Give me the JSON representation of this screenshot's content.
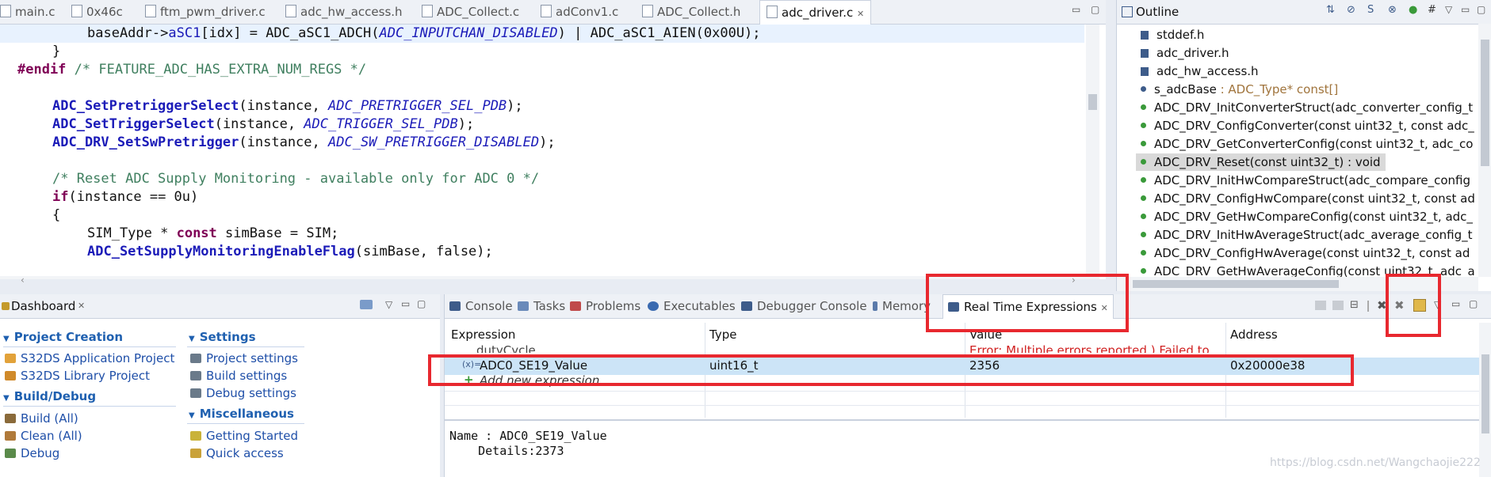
{
  "editor": {
    "tabs": [
      "main.c",
      "0x46c",
      "ftm_pwm_driver.c",
      "adc_hw_access.h",
      "ADC_Collect.c",
      "adConv1.c",
      "ADC_Collect.h",
      "adc_driver.c"
    ],
    "active_tab_close": "✕",
    "lines": {
      "l1_a": "baseAddr->",
      "l1_b": "aSC1",
      "l1_c": "[idx] = ADC_aSC1_ADCH(",
      "l1_d": "ADC_INPUTCHAN_DISABLED",
      "l1_e": ") | ADC_aSC1_AIEN(0x00U);",
      "l2": "}",
      "l3_a": "#endif",
      "l3_b": " /* FEATURE_ADC_HAS_EXTRA_NUM_REGS */",
      "l4_a": "ADC_SetPretriggerSelect",
      "l4_b": "(instance, ",
      "l4_c": "ADC_PRETRIGGER_SEL_PDB",
      "l4_d": ");",
      "l5_a": "ADC_SetTriggerSelect",
      "l5_b": "(instance, ",
      "l5_c": "ADC_TRIGGER_SEL_PDB",
      "l5_d": ");",
      "l6_a": "ADC_DRV_SetSwPretrigger",
      "l6_b": "(instance, ",
      "l6_c": "ADC_SW_PRETRIGGER_DISABLED",
      "l6_d": ");",
      "l7": "/* Reset ADC Supply Monitoring - available only for ADC 0 */",
      "l8_a": "if",
      "l8_b": "(instance == 0u)",
      "l9": "{",
      "l10_a": "SIM_Type * ",
      "l10_b": "const",
      "l10_c": " simBase = SIM;",
      "l11_a": "ADC_SetSupplyMonitoringEnableFlag",
      "l11_b": "(simBase, false);"
    }
  },
  "outline": {
    "title": "Outline",
    "items": [
      {
        "label": "stddef.h",
        "kind": "header"
      },
      {
        "label": "adc_driver.h",
        "kind": "header"
      },
      {
        "label": "adc_hw_access.h",
        "kind": "header"
      },
      {
        "label": "s_adcBase",
        "type": " : ADC_Type* const[]",
        "kind": "static"
      },
      {
        "label": "ADC_DRV_InitConverterStruct(adc_converter_config_t",
        "kind": "fn"
      },
      {
        "label": "ADC_DRV_ConfigConverter(const uint32_t, const adc_",
        "kind": "fn"
      },
      {
        "label": "ADC_DRV_GetConverterConfig(const uint32_t, adc_co",
        "kind": "fn"
      },
      {
        "label": "ADC_DRV_Reset(const uint32_t) : void",
        "kind": "fn",
        "selected": true
      },
      {
        "label": "ADC_DRV_InitHwCompareStruct(adc_compare_config",
        "kind": "fn"
      },
      {
        "label": "ADC_DRV_ConfigHwCompare(const uint32_t, const ad",
        "kind": "fn"
      },
      {
        "label": "ADC_DRV_GetHwCompareConfig(const uint32_t, adc_",
        "kind": "fn"
      },
      {
        "label": "ADC_DRV_InitHwAverageStruct(adc_average_config_t",
        "kind": "fn"
      },
      {
        "label": "ADC_DRV_ConfigHwAverage(const uint32_t, const ad",
        "kind": "fn"
      },
      {
        "label": "ADC_DRV_GetHwAverageConfig(const uint32_t, adc_a",
        "kind": "fn"
      }
    ]
  },
  "dashboard": {
    "title": "Dashboard",
    "sections": {
      "project_creation": "Project Creation",
      "build_debug": "Build/Debug",
      "settings": "Settings",
      "misc": "Miscellaneous"
    },
    "links": {
      "app_project": "S32DS Application Project",
      "lib_project": "S32DS Library Project",
      "build": "Build  (All)",
      "clean": "Clean  (All)",
      "debug": "Debug",
      "project_settings": "Project settings",
      "build_settings": "Build settings",
      "debug_settings": "Debug settings",
      "getting_started": "Getting Started",
      "quick_access": "Quick access"
    }
  },
  "bottom_tabs": [
    "Console",
    "Tasks",
    "Problems",
    "Executables",
    "Debugger Console",
    "Memory",
    "Real Time Expressions"
  ],
  "expressions": {
    "headers": {
      "expression": "Expression",
      "type": "Type",
      "value": "Value",
      "address": "Address"
    },
    "partial_row": {
      "expression": "dutyCycle",
      "value": "Error: Multiple errors reported.) Failed to"
    },
    "row": {
      "expression": "ADC0_SE19_Value",
      "type": "uint16_t",
      "value": "2356",
      "address": "0x20000e38",
      "prefix": "(x)="
    },
    "add_new": "Add new expression",
    "details_line1": "Name : ADC0_SE19_Value",
    "details_line2": "    Details:2373"
  },
  "watermark": "https://blog.csdn.net/Wangchaojie222"
}
